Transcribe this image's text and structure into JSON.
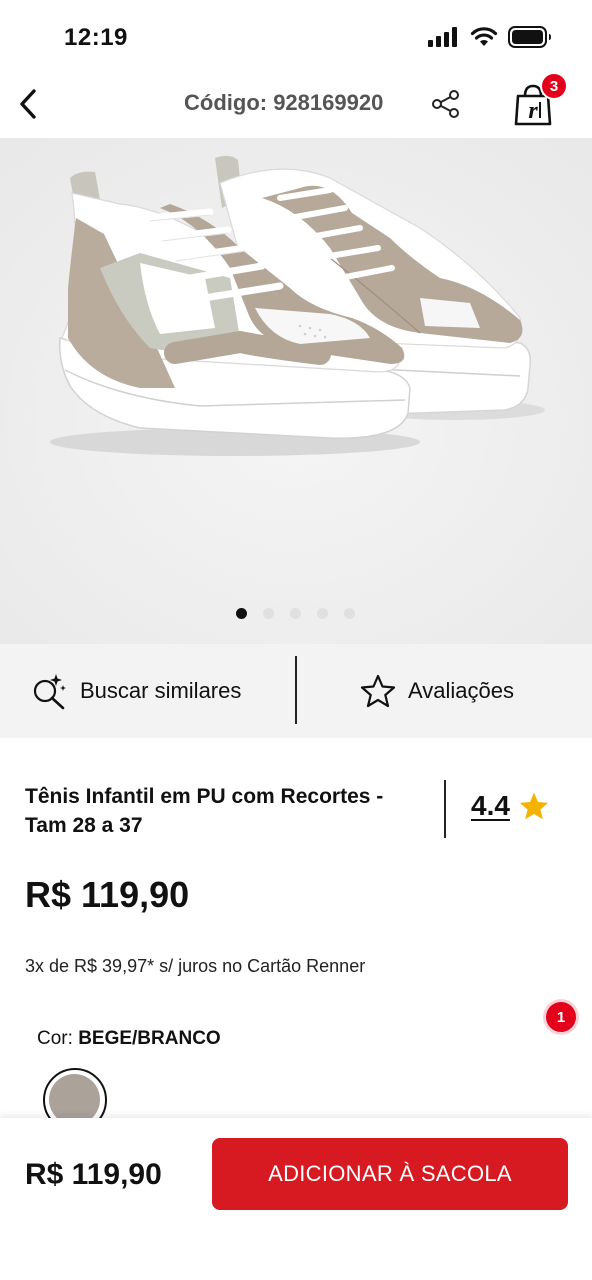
{
  "status_bar": {
    "time": "12:19"
  },
  "header": {
    "code_label": "Código: 928169920",
    "cart_count": "3"
  },
  "gallery": {
    "total_images": 5,
    "active_index": 0
  },
  "actions": {
    "similar_label": "Buscar similares",
    "reviews_label": "Avaliações"
  },
  "product": {
    "title": "Tênis Infantil em PU com Recortes - Tam 28 a 37",
    "rating": "4.4",
    "price": "R$ 119,90",
    "installments": "3x de R$ 39,97* s/ juros no Cartão Renner",
    "color_label": "Cor:",
    "color_value": "BEGE/BRANCO",
    "swatch_color": "#aba29a"
  },
  "notification_count": "1",
  "bottom": {
    "price": "R$ 119,90",
    "add_button": "ADICIONAR À SACOLA"
  },
  "colors": {
    "accent": "#d71921",
    "badge": "#e3001b",
    "star": "#f5b301"
  }
}
